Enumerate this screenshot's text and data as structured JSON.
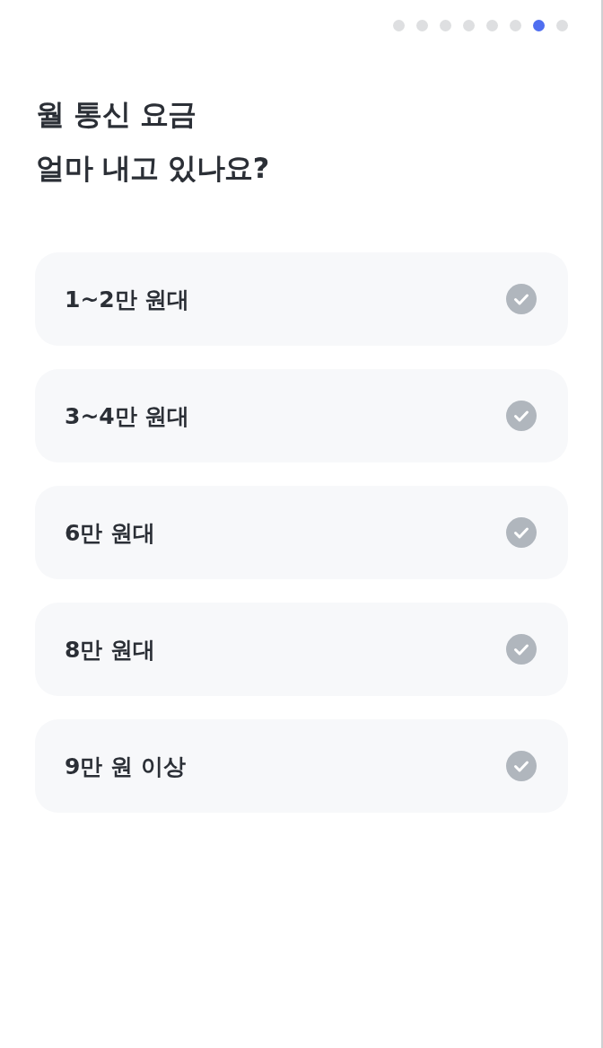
{
  "pager": {
    "pages": [
      {
        "selected": false
      },
      {
        "selected": false
      },
      {
        "selected": false
      },
      {
        "selected": false
      },
      {
        "selected": false
      },
      {
        "selected": false
      },
      {
        "selected": true
      },
      {
        "selected": false
      }
    ]
  },
  "title": [
    "월 통신 요금",
    "얼마 내고 있나요?"
  ],
  "options": [
    {
      "label": "1~2만 원대",
      "selected": false
    },
    {
      "label": "3~4만 원대",
      "selected": false
    },
    {
      "label": "6만 원대",
      "selected": false
    },
    {
      "label": "8만 원대",
      "selected": false
    },
    {
      "label": "9만 원 이상",
      "selected": false
    }
  ]
}
